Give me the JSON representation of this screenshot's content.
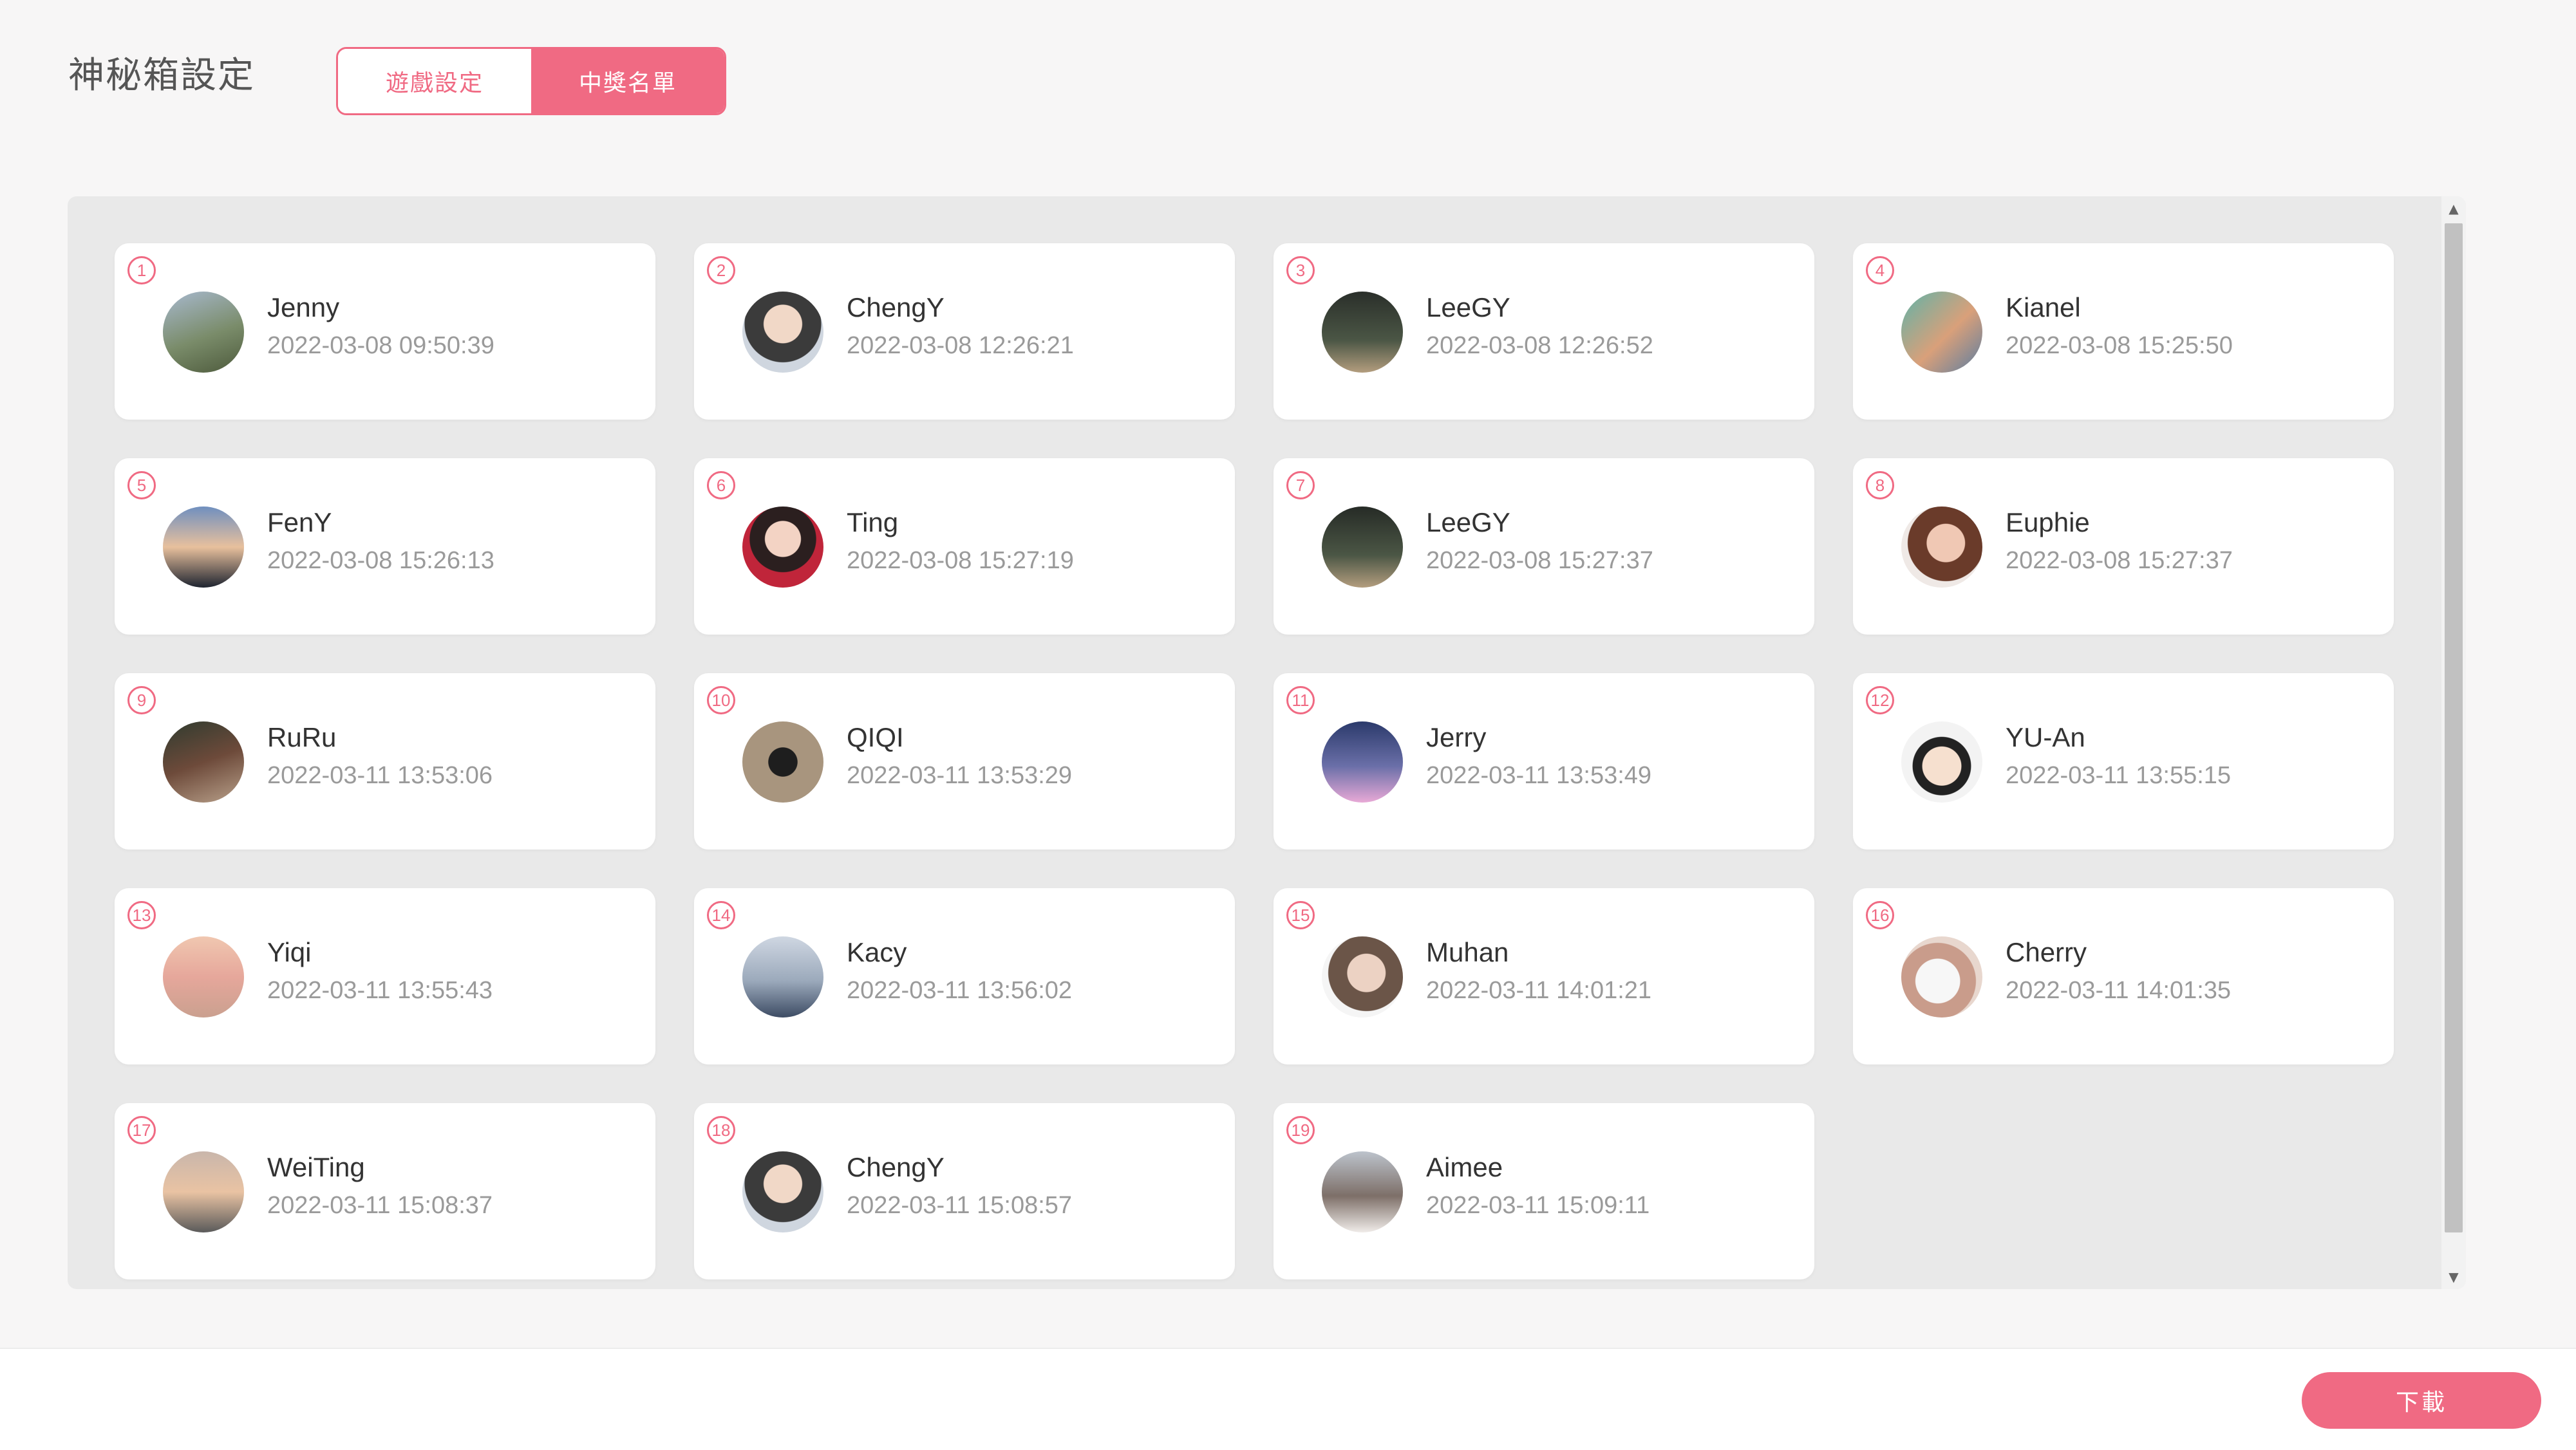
{
  "header": {
    "title": "神秘箱設定",
    "tabs": [
      {
        "label": "遊戲設定",
        "active": false
      },
      {
        "label": "中獎名單",
        "active": true
      }
    ]
  },
  "colors": {
    "accent": "#f06a83"
  },
  "winners": [
    {
      "rank": "1",
      "name": "Jenny",
      "time": "2022-03-08 09:50:39",
      "avatar": "linear-gradient(160deg,#a8b9cf 0%,#7a8c6a 55%,#4d5a3c 100%)"
    },
    {
      "rank": "2",
      "name": "ChengY",
      "time": "2022-03-08 12:26:21",
      "avatar": "radial-gradient(circle at 50% 40%,#f1d8c7 0 30%,#3b3b3b 31% 60%,#cfd6df 61%)"
    },
    {
      "rank": "3",
      "name": "LeeGY",
      "time": "2022-03-08 12:26:52",
      "avatar": "linear-gradient(180deg,#2a2f2a 0%,#4b5645 60%,#b39d7e 100%)"
    },
    {
      "rank": "4",
      "name": "Kianel",
      "time": "2022-03-08 15:25:50",
      "avatar": "linear-gradient(135deg,#5fb3a8 0%,#d9a07a 55%,#5a7da1 100%)"
    },
    {
      "rank": "5",
      "name": "FenY",
      "time": "2022-03-08 15:26:13",
      "avatar": "linear-gradient(180deg,#6f8fbf 0%,#e8c09d 50%,#1e2430 100%)"
    },
    {
      "rank": "6",
      "name": "Ting",
      "time": "2022-03-08 15:27:19",
      "avatar": "radial-gradient(circle at 50% 40%,#f3d3c4 0 28%,#2b1f1f 29% 52%,#c0253a 53%)"
    },
    {
      "rank": "7",
      "name": "LeeGY",
      "time": "2022-03-08 15:27:37",
      "avatar": "linear-gradient(180deg,#262b26 0%,#4b5645 60%,#b39d7e 100%)"
    },
    {
      "rank": "8",
      "name": "Euphie",
      "time": "2022-03-08 15:27:37",
      "avatar": "radial-gradient(circle at 55% 45%,#f0c8b4 0 30%,#6a3b2a 31% 60%,#efe9e6 61%)"
    },
    {
      "rank": "9",
      "name": "RuRu",
      "time": "2022-03-11 13:53:06",
      "avatar": "linear-gradient(160deg,#2f3b2f 0%,#6d4a3a 50%,#b8a08a 100%)"
    },
    {
      "rank": "10",
      "name": "QIQI",
      "time": "2022-03-11 13:53:29",
      "avatar": "radial-gradient(circle at 50% 50%,#1e1e1e 0 25%,#a8957e 26%)"
    },
    {
      "rank": "11",
      "name": "Jerry",
      "time": "2022-03-11 13:53:49",
      "avatar": "linear-gradient(180deg,#2b3a6b 0%,#6a6fa8 55%,#e8a9d6 100%)"
    },
    {
      "rank": "12",
      "name": "YU-An",
      "time": "2022-03-11 13:55:15",
      "avatar": "radial-gradient(circle at 50% 55%,#f6e0cf 0 32%,#222 33% 48%,#f3f3f3 49%)"
    },
    {
      "rank": "13",
      "name": "Yiqi",
      "time": "2022-03-11 13:55:43",
      "avatar": "linear-gradient(180deg,#f0c7b0 0%,#e6a79b 50%,#caa08f 100%)"
    },
    {
      "rank": "14",
      "name": "Kacy",
      "time": "2022-03-11 13:56:02",
      "avatar": "linear-gradient(180deg,#cfd7e2 0%,#9ba9bb 55%,#3d4c64 100%)"
    },
    {
      "rank": "15",
      "name": "Muhan",
      "time": "2022-03-11 14:01:21",
      "avatar": "radial-gradient(circle at 55% 45%,#ecd2c3 0 30%,#6b5548 31% 60%,#f5f5f5 61%)"
    },
    {
      "rank": "16",
      "name": "Cherry",
      "time": "2022-03-11 14:01:35",
      "avatar": "radial-gradient(circle at 45% 55%,#f7f7f7 0 35%,#c99c8b 36% 60%,#e8d7ce 61%)"
    },
    {
      "rank": "17",
      "name": "WeiTing",
      "time": "2022-03-11 15:08:37",
      "avatar": "linear-gradient(180deg,#c9b6ab 0%,#e9c3a3 50%,#5a5a5a 100%)"
    },
    {
      "rank": "18",
      "name": "ChengY",
      "time": "2022-03-11 15:08:57",
      "avatar": "radial-gradient(circle at 50% 40%,#f1d8c7 0 30%,#3b3b3b 31% 60%,#cfd6df 61%)"
    },
    {
      "rank": "19",
      "name": "Aimee",
      "time": "2022-03-11 15:09:11",
      "avatar": "linear-gradient(180deg,#bcc3cc 0%,#7d6f68 55%,#f0ece9 100%)"
    }
  ],
  "footer": {
    "download_label": "下載"
  }
}
